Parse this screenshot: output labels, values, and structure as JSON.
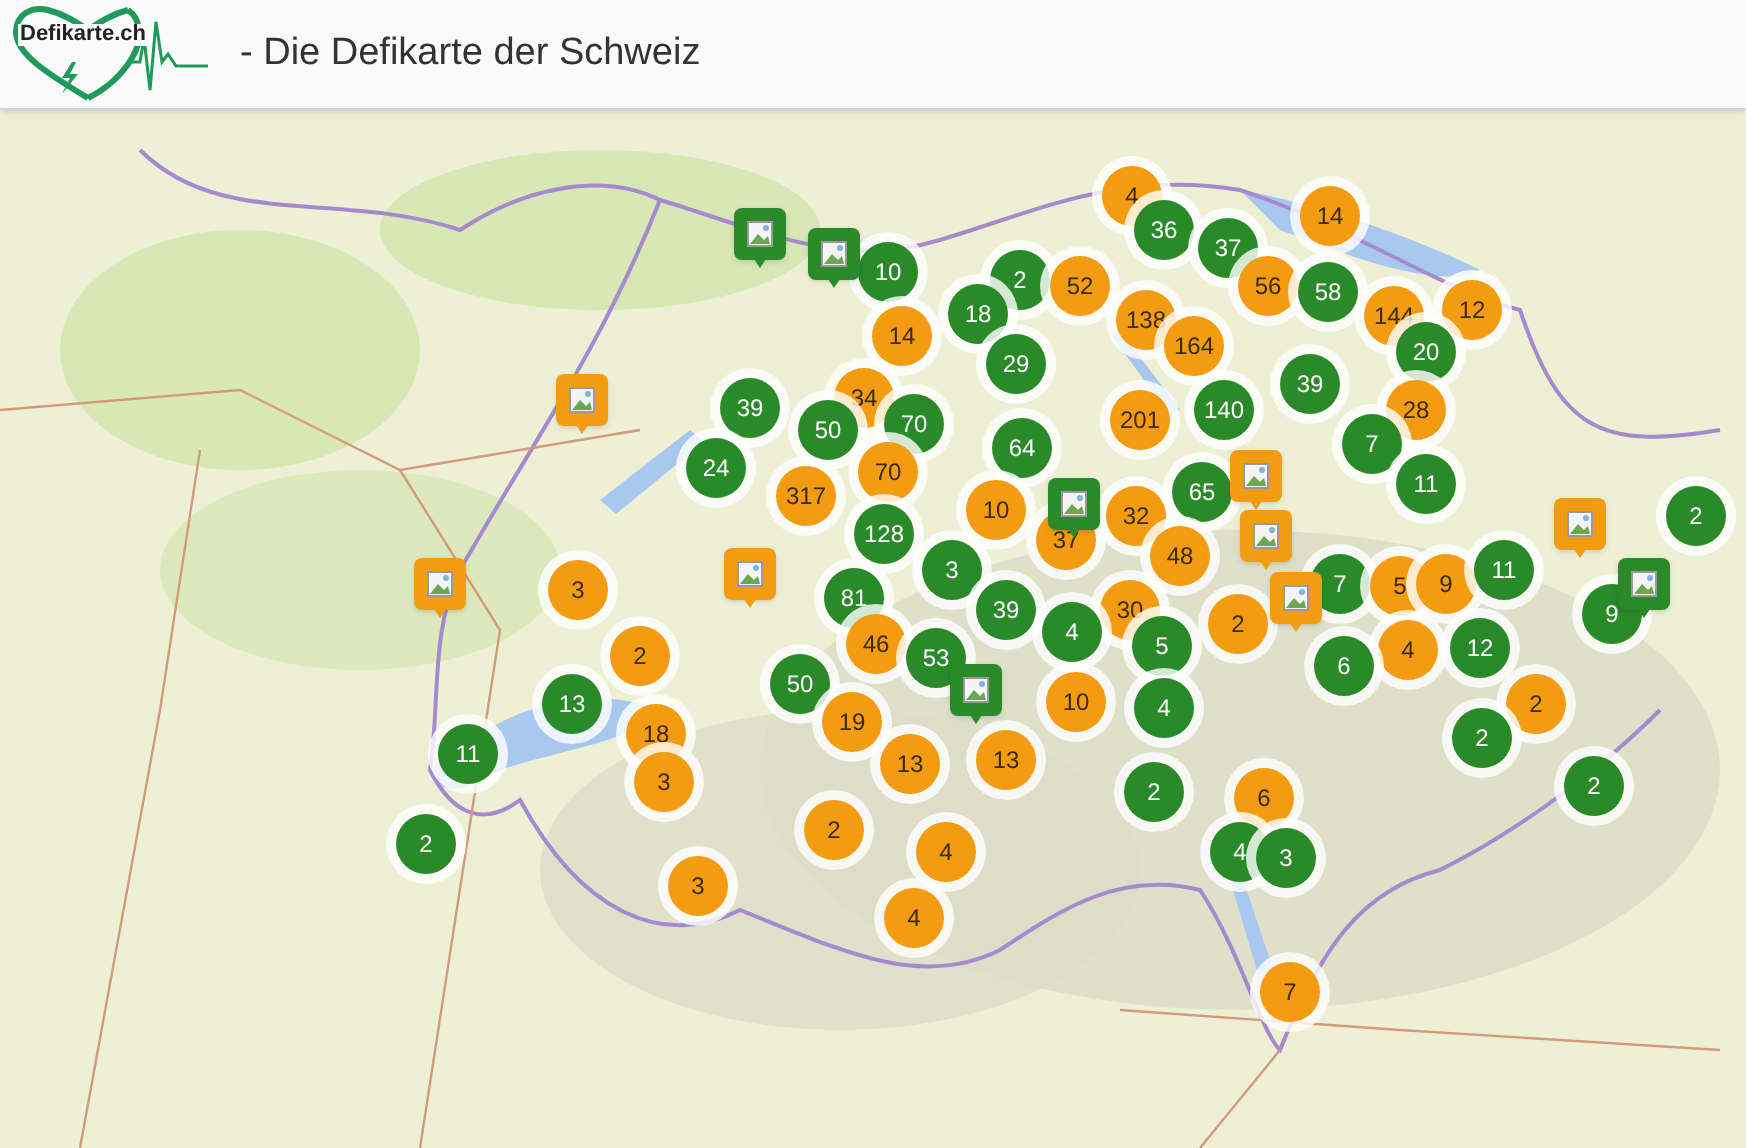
{
  "header": {
    "logo_text": "Defikarte.ch",
    "title": "- Die Defikarte der Schweiz"
  },
  "map": {
    "clusters": [
      {
        "label": "4",
        "color": "#f39c12"
      },
      {
        "label": "36",
        "color": "#2a8a2a"
      },
      {
        "label": "14",
        "color": "#f39c12"
      },
      {
        "label": "37",
        "color": "#2a8a2a"
      },
      {
        "label": "2",
        "color": "#2a8a2a"
      },
      {
        "label": "52",
        "color": "#f39c12"
      },
      {
        "label": "56",
        "color": "#f39c12"
      },
      {
        "label": "58",
        "color": "#2a8a2a"
      },
      {
        "label": "144",
        "color": "#f39c12"
      },
      {
        "label": "12",
        "color": "#f39c12"
      },
      {
        "label": "10",
        "color": "#2a8a2a"
      },
      {
        "label": "18",
        "color": "#2a8a2a"
      },
      {
        "label": "14",
        "color": "#f39c12"
      },
      {
        "label": "138",
        "color": "#f39c12"
      },
      {
        "label": "164",
        "color": "#f39c12"
      },
      {
        "label": "29",
        "color": "#2a8a2a"
      },
      {
        "label": "20",
        "color": "#2a8a2a"
      },
      {
        "label": "39",
        "color": "#2a8a2a"
      },
      {
        "label": "28",
        "color": "#f39c12"
      },
      {
        "label": "34",
        "color": "#f39c12"
      },
      {
        "label": "39",
        "color": "#2a8a2a"
      },
      {
        "label": "50",
        "color": "#2a8a2a"
      },
      {
        "label": "70",
        "color": "#2a8a2a"
      },
      {
        "label": "201",
        "color": "#f39c12"
      },
      {
        "label": "140",
        "color": "#2a8a2a"
      },
      {
        "label": "64",
        "color": "#2a8a2a"
      },
      {
        "label": "7",
        "color": "#2a8a2a"
      },
      {
        "label": "24",
        "color": "#2a8a2a"
      },
      {
        "label": "70",
        "color": "#f39c12"
      },
      {
        "label": "11",
        "color": "#2a8a2a"
      },
      {
        "label": "317",
        "color": "#f39c12"
      },
      {
        "label": "10",
        "color": "#f39c12"
      },
      {
        "label": "65",
        "color": "#2a8a2a"
      },
      {
        "label": "32",
        "color": "#f39c12"
      },
      {
        "label": "128",
        "color": "#2a8a2a"
      },
      {
        "label": "48",
        "color": "#f39c12"
      },
      {
        "label": "37",
        "color": "#f39c12"
      },
      {
        "label": "3",
        "color": "#2a8a2a"
      },
      {
        "label": "2",
        "color": "#2a8a2a"
      },
      {
        "label": "7",
        "color": "#2a8a2a"
      },
      {
        "label": "5",
        "color": "#f39c12"
      },
      {
        "label": "9",
        "color": "#f39c12"
      },
      {
        "label": "11",
        "color": "#2a8a2a"
      },
      {
        "label": "3",
        "color": "#f39c12"
      },
      {
        "label": "81",
        "color": "#2a8a2a"
      },
      {
        "label": "39",
        "color": "#2a8a2a"
      },
      {
        "label": "30",
        "color": "#f39c12"
      },
      {
        "label": "2",
        "color": "#f39c12"
      },
      {
        "label": "9",
        "color": "#2a8a2a"
      },
      {
        "label": "4",
        "color": "#2a8a2a"
      },
      {
        "label": "5",
        "color": "#2a8a2a"
      },
      {
        "label": "4",
        "color": "#f39c12"
      },
      {
        "label": "12",
        "color": "#2a8a2a"
      },
      {
        "label": "6",
        "color": "#2a8a2a"
      },
      {
        "label": "2",
        "color": "#f39c12"
      },
      {
        "label": "46",
        "color": "#f39c12"
      },
      {
        "label": "53",
        "color": "#2a8a2a"
      },
      {
        "label": "13",
        "color": "#2a8a2a"
      },
      {
        "label": "50",
        "color": "#2a8a2a"
      },
      {
        "label": "19",
        "color": "#f39c12"
      },
      {
        "label": "18",
        "color": "#f39c12"
      },
      {
        "label": "10",
        "color": "#f39c12"
      },
      {
        "label": "4",
        "color": "#2a8a2a"
      },
      {
        "label": "2",
        "color": "#f39c12"
      },
      {
        "label": "2",
        "color": "#2a8a2a"
      },
      {
        "label": "11",
        "color": "#2a8a2a"
      },
      {
        "label": "3",
        "color": "#f39c12"
      },
      {
        "label": "13",
        "color": "#f39c12"
      },
      {
        "label": "13",
        "color": "#f39c12"
      },
      {
        "label": "2",
        "color": "#2a8a2a"
      },
      {
        "label": "2",
        "color": "#2a8a2a"
      },
      {
        "label": "6",
        "color": "#f39c12"
      },
      {
        "label": "2",
        "color": "#f39c12"
      },
      {
        "label": "4",
        "color": "#f39c12"
      },
      {
        "label": "4",
        "color": "#2a8a2a"
      },
      {
        "label": "3",
        "color": "#2a8a2a"
      },
      {
        "label": "2",
        "color": "#2a8a2a"
      },
      {
        "label": "3",
        "color": "#f39c12"
      },
      {
        "label": "4",
        "color": "#f39c12"
      },
      {
        "label": "7",
        "color": "#f39c12"
      }
    ],
    "pins": [
      {
        "color": "#f39c12"
      },
      {
        "color": "#f39c12"
      },
      {
        "color": "#f39c12"
      },
      {
        "color": "#f39c12"
      },
      {
        "color": "#f39c12"
      },
      {
        "color": "#f39c12"
      },
      {
        "color": "#f39c12"
      },
      {
        "color": "#2a8a2a"
      },
      {
        "color": "#2a8a2a"
      },
      {
        "color": "#2a8a2a"
      },
      {
        "color": "#2a8a2a"
      },
      {
        "color": "#2a8a2a"
      }
    ]
  }
}
